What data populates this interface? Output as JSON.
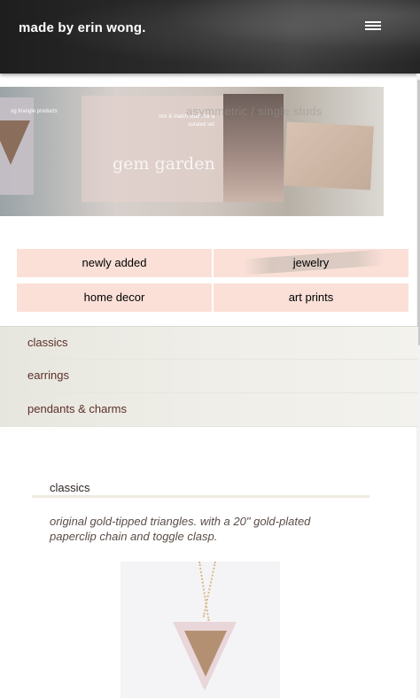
{
  "header": {
    "site_title": "made by erin wong."
  },
  "banner": {
    "small_text_left": "og triangle products",
    "small_text_right": "mix & match studs for a curated set",
    "gem_text": "gem garden",
    "overlay_text": "asymmetric / single studs"
  },
  "categories": [
    {
      "label": "newly added"
    },
    {
      "label": "jewelry"
    },
    {
      "label": "home decor"
    },
    {
      "label": "art prints"
    }
  ],
  "subnav": [
    {
      "label": "classics"
    },
    {
      "label": "earrings"
    },
    {
      "label": "pendants & charms"
    }
  ],
  "section": {
    "heading": "classics",
    "description": "original gold-tipped triangles. with a 20\" gold-plated paperclip chain and toggle clasp."
  },
  "colors": {
    "header_bg": "#2a2a2a",
    "category_bg": "#fbe0d8",
    "subnav_text": "#5b2f2a"
  }
}
